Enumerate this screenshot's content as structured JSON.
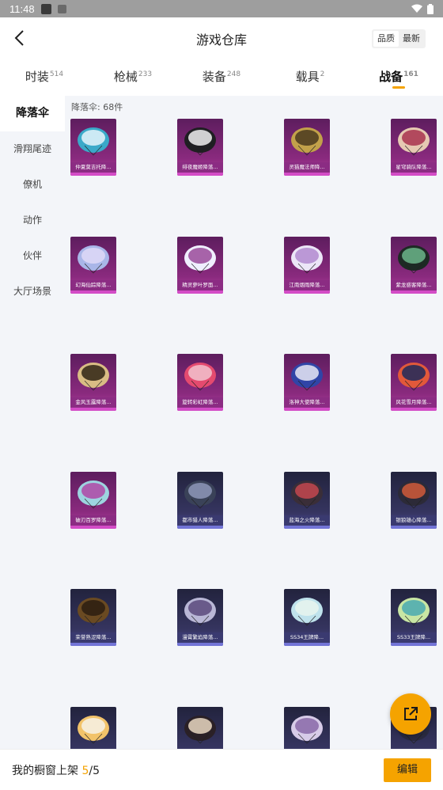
{
  "status_bar": {
    "time": "11:48"
  },
  "header": {
    "title": "游戏仓库",
    "sort_options": [
      "品质",
      "最新"
    ],
    "selected_sort": "品质"
  },
  "tabs": [
    {
      "label": "时装",
      "count": "514",
      "active": false
    },
    {
      "label": "枪械",
      "count": "233",
      "active": false
    },
    {
      "label": "装备",
      "count": "248",
      "active": false
    },
    {
      "label": "载具",
      "count": "2",
      "active": false
    },
    {
      "label": "战备",
      "count": "161",
      "active": true
    }
  ],
  "sidebar": {
    "items": [
      {
        "label": "降落伞",
        "active": true
      },
      {
        "label": "滑翔尾迹",
        "active": false
      },
      {
        "label": "僚机",
        "active": false
      },
      {
        "label": "动作",
        "active": false
      },
      {
        "label": "伙伴",
        "active": false
      },
      {
        "label": "大厅场景",
        "active": false
      }
    ]
  },
  "content": {
    "count_label": "降落伞: 68件",
    "items": [
      {
        "name": "仲夏莫吉托降...",
        "rarity": "purple",
        "colors": [
          "#3aa9c9",
          "#e6f5fb"
        ]
      },
      {
        "name": "绯夜魔姬降落...",
        "rarity": "purple",
        "colors": [
          "#1f1f22",
          "#f0f0f0"
        ]
      },
      {
        "name": "灵猫魔法师降...",
        "rarity": "purple",
        "colors": [
          "#c2a14a",
          "#4a3a1e"
        ]
      },
      {
        "name": "星穹骑队降落...",
        "rarity": "purple",
        "colors": [
          "#e6c9b2",
          "#a8324e"
        ]
      },
      {
        "name": "幻海仙踪降落...",
        "rarity": "purple",
        "colors": [
          "#a9b6e8",
          "#dfd9f7"
        ]
      },
      {
        "name": "精灵萝叶罗面...",
        "rarity": "purple",
        "colors": [
          "#f0efff",
          "#9a4a9a"
        ]
      },
      {
        "name": "江南烟雨降落...",
        "rarity": "purple",
        "colors": [
          "#ece6f7",
          "#b38ad0"
        ]
      },
      {
        "name": "紫龙惑客降落...",
        "rarity": "purple",
        "colors": [
          "#1d2a24",
          "#6bb58a"
        ]
      },
      {
        "name": "金风玉露降落...",
        "rarity": "purple",
        "colors": [
          "#d9bc84",
          "#2f2414"
        ]
      },
      {
        "name": "旋转彩虹降落...",
        "rarity": "purple",
        "colors": [
          "#e44a6f",
          "#f2c2ce"
        ]
      },
      {
        "name": "洛神大使降落...",
        "rarity": "purple",
        "colors": [
          "#3045a7",
          "#e8e8f5"
        ]
      },
      {
        "name": "风花雪月降落...",
        "rarity": "purple",
        "colors": [
          "#e2593a",
          "#1e2a5c"
        ]
      },
      {
        "name": "破刃百罗降落...",
        "rarity": "purple",
        "colors": [
          "#9dd4e0",
          "#b048a6"
        ]
      },
      {
        "name": "都市猎人降落...",
        "rarity": "navy",
        "colors": [
          "#3a4258",
          "#8e97b8"
        ]
      },
      {
        "name": "蓝海之火降落...",
        "rarity": "navy",
        "colors": [
          "#3a2e38",
          "#c4464f"
        ]
      },
      {
        "name": "银狼雄心降落...",
        "rarity": "navy",
        "colors": [
          "#2c2a38",
          "#d15a3a"
        ]
      },
      {
        "name": "荣誉熟涩降落...",
        "rarity": "navy",
        "colors": [
          "#6a4a22",
          "#2c1d10"
        ]
      },
      {
        "name": "漫霄繁焰降落...",
        "rarity": "navy",
        "colors": [
          "#b9b7d6",
          "#5a4a7c"
        ]
      },
      {
        "name": "SS34王牌降...",
        "rarity": "navy",
        "colors": [
          "#bfe2ec",
          "#e8f4ef"
        ]
      },
      {
        "name": "SS33王牌降...",
        "rarity": "navy",
        "colors": [
          "#c8e6a4",
          "#4aa9b2"
        ]
      },
      {
        "name": "",
        "rarity": "navy",
        "colors": [
          "#f2c36a",
          "#f7f2e6"
        ]
      },
      {
        "name": "",
        "rarity": "navy",
        "colors": [
          "#2a2026",
          "#e9d8c2"
        ]
      },
      {
        "name": "",
        "rarity": "navy",
        "colors": [
          "#d7cbe8",
          "#8a6aa8"
        ]
      },
      {
        "name": "",
        "rarity": "navy",
        "colors": [
          "#2a2a40",
          "#6a6a9a"
        ]
      }
    ]
  },
  "footer": {
    "label": "我的橱窗上架",
    "current": "5",
    "separator": "/",
    "total": "5",
    "edit_label": "编辑"
  },
  "accent_color": "#f5a300"
}
